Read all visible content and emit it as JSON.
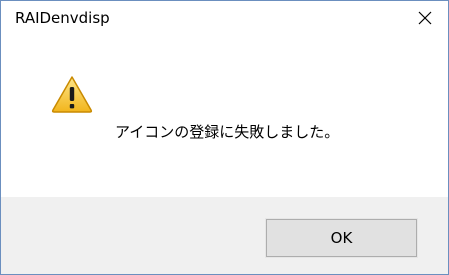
{
  "window": {
    "title": "RAIDenvdisp",
    "close_icon": "close-icon"
  },
  "dialog": {
    "icon": "warning-icon",
    "message": "アイコンの登録に失敗しました。"
  },
  "buttons": {
    "ok_label": "OK"
  },
  "colors": {
    "window_border": "#6b8fbf",
    "footer_bg": "#f0f0f0",
    "button_bg": "#e1e1e1",
    "button_border": "#adadad",
    "warning_fill": "#f7c53c",
    "warning_edge": "#c98a00"
  }
}
